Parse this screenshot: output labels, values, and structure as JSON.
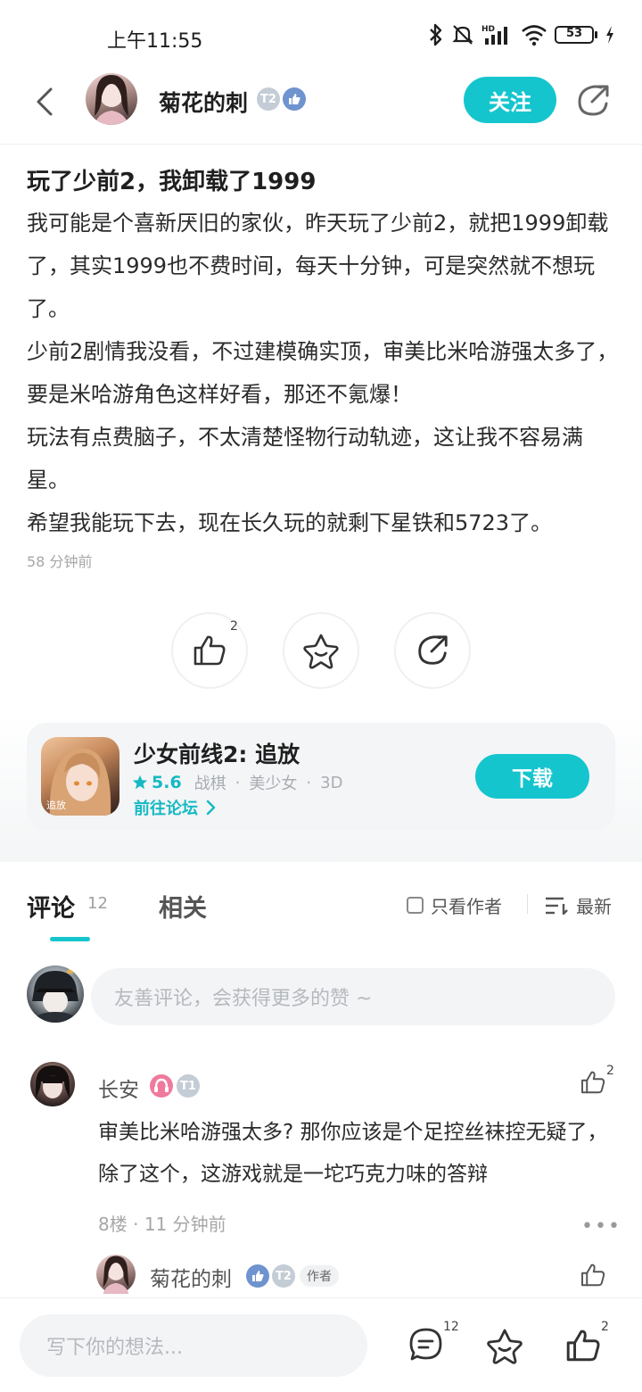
{
  "status_bar": {
    "time": "上午11:55",
    "battery": "53",
    "network_label": "HD"
  },
  "header": {
    "author_name": "菊花的刺",
    "author_level": "T2",
    "follow_label": "关注"
  },
  "post": {
    "title": "玩了少前2，我卸载了1999",
    "paragraphs": [
      "我可能是个喜新厌旧的家伙，昨天玩了少前2，就把1999卸载了，其实1999也不费时间，每天十分钟，可是突然就不想玩了。",
      "少前2剧情我没看，不过建模确实顶，审美比米哈游强太多了，要是米哈游角色这样好看，那还不氪爆！",
      "玩法有点费脑子，不太清楚怪物行动轨迹，这让我不容易满星。",
      "希望我能玩下去，现在长久玩的就剩下星铁和5723了。"
    ],
    "time_ago": "58 分钟前",
    "like_count": "2"
  },
  "game_card": {
    "icon_tag": "追放",
    "title": "少女前线2: 追放",
    "rating": "5.6",
    "tags": [
      "战棋",
      "美少女",
      "3D"
    ],
    "forum_link": "前往论坛",
    "download_label": "下载"
  },
  "tabs": {
    "comments_label": "评论",
    "comments_count": "12",
    "related_label": "相关",
    "author_only_label": "只看作者",
    "sort_label": "最新"
  },
  "comment_input": {
    "placeholder": "友善评论，会获得更多的赞 ~"
  },
  "comments": [
    {
      "name": "长安",
      "level": "T1",
      "like_count": "2",
      "text": "审美比米哈游强太多? 那你应该是个足控丝袜控无疑了，除了这个，这游戏就是一坨巧克力味的答辩",
      "floor": "8楼",
      "time_ago": "11 分钟前"
    }
  ],
  "reply": {
    "name": "菊花的刺",
    "level": "T2",
    "author_tag": "作者"
  },
  "bottom_bar": {
    "placeholder": "写下你的想法...",
    "comment_count": "12",
    "like_count": "2"
  },
  "colors": {
    "accent": "#15c5ce",
    "background": "#ffffff",
    "card": "#f3f5f7"
  }
}
